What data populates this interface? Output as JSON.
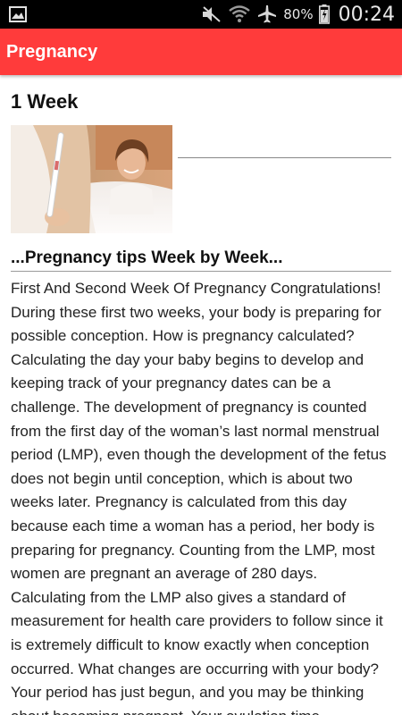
{
  "status_bar": {
    "left_icon": "image-icon",
    "icons": [
      "mute-icon",
      "wifi-icon",
      "airplane-icon",
      "battery-icon"
    ],
    "battery": "80%",
    "time": "00:24"
  },
  "app_bar": {
    "title": "Pregnancy",
    "color": "#ff3b3b"
  },
  "article": {
    "week_title": "1 Week",
    "subtitle": "...Pregnancy tips Week by Week...",
    "body": "First And Second Week Of Pregnancy Congratulations! During these first two weeks, your body is preparing for possible conception. How is pregnancy calculated? Calculating the day your baby begins to develop and keeping track of your pregnancy dates can be a challenge. The development of pregnancy is counted from the first day of the woman’s last normal menstrual period (LMP), even though the development of the fetus does not begin until conception, which is about two weeks later. Pregnancy is calculated from this day because each time a woman has a period, her body is preparing for pregnancy. Counting from the LMP, most women are pregnant an average of 280 days. Calculating from the LMP also gives a standard of measurement for health care providers to follow since it is extremely difficult to know exactly when conception occurred. What changes are occurring with your body? Your period has just begun, and you may be thinking about becoming pregnant. Your ovulation time"
  }
}
